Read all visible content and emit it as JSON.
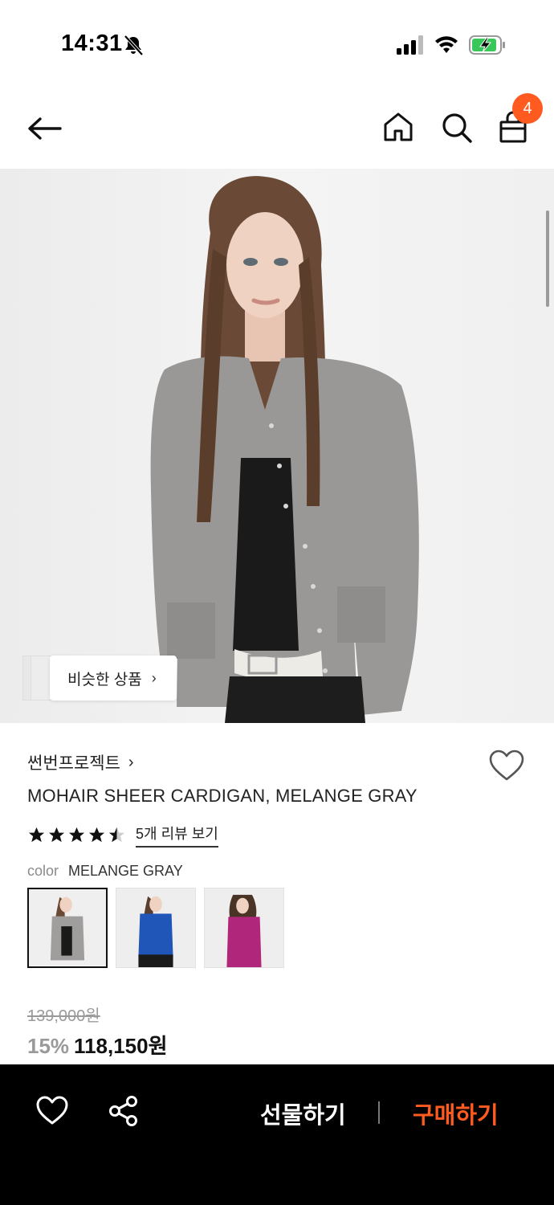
{
  "status_bar": {
    "time": "14:31"
  },
  "header": {
    "cart_count": "4"
  },
  "hero": {
    "similar_label": "비슷한 상품"
  },
  "product": {
    "brand": "썬번프로젝트",
    "name": "MOHAIR SHEER CARDIGAN, MELANGE GRAY",
    "rating": 4.5,
    "review_link": "5개 리뷰 보기",
    "color_label": "color",
    "color_value": "MELANGE GRAY",
    "swatches": [
      "melange-gray",
      "blue",
      "magenta"
    ],
    "original_price": "139,000원",
    "discount": "15%",
    "sale_price": "118,150원"
  },
  "bottom_bar": {
    "gift_label": "선물하기",
    "buy_label": "구매하기"
  },
  "colors": {
    "accent": "#ff5a1f",
    "bar_bg": "#000000"
  }
}
